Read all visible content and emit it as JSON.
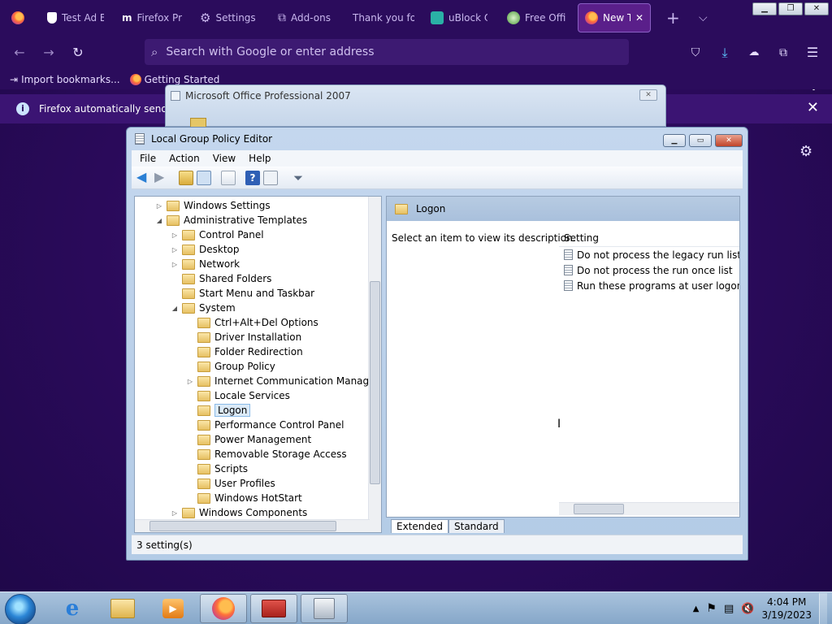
{
  "browser": {
    "tabs": [
      {
        "label": "Test Ad B",
        "icon": "shield-icon"
      },
      {
        "label": "Firefox Pr",
        "icon": "mozilla-m-icon"
      },
      {
        "label": "Settings",
        "icon": "gear-icon"
      },
      {
        "label": "Add-ons",
        "icon": "puzzle-icon"
      },
      {
        "label": "Thank you fo",
        "icon": ""
      },
      {
        "label": "uBlock O",
        "icon": "ublock-icon"
      },
      {
        "label": "Free Offic",
        "icon": "office-icon"
      },
      {
        "label": "New Ta",
        "icon": "firefox-icon",
        "active": true
      }
    ],
    "url_placeholder": "Search with Google or enter address",
    "bookmarks": [
      {
        "label": "Import bookmarks...",
        "icon": "import-icon"
      },
      {
        "label": "Getting Started",
        "icon": "firefox-icon"
      }
    ],
    "notification": "Firefox automatically sends so"
  },
  "background_dialog": {
    "title": "Microsoft Office Professional 2007"
  },
  "gpe": {
    "title": "Local Group Policy Editor",
    "menu": [
      "File",
      "Action",
      "View",
      "Help"
    ],
    "tree": [
      {
        "label": "Windows Settings",
        "level": 0,
        "exp": "▷"
      },
      {
        "label": "Administrative Templates",
        "level": 0,
        "exp": "◢"
      },
      {
        "label": "Control Panel",
        "level": 1,
        "exp": "▷"
      },
      {
        "label": "Desktop",
        "level": 1,
        "exp": "▷"
      },
      {
        "label": "Network",
        "level": 1,
        "exp": "▷"
      },
      {
        "label": "Shared Folders",
        "level": 1,
        "exp": ""
      },
      {
        "label": "Start Menu and Taskbar",
        "level": 1,
        "exp": ""
      },
      {
        "label": "System",
        "level": 1,
        "exp": "◢"
      },
      {
        "label": "Ctrl+Alt+Del Options",
        "level": 2,
        "exp": ""
      },
      {
        "label": "Driver Installation",
        "level": 2,
        "exp": ""
      },
      {
        "label": "Folder Redirection",
        "level": 2,
        "exp": ""
      },
      {
        "label": "Group Policy",
        "level": 2,
        "exp": ""
      },
      {
        "label": "Internet Communication Managen",
        "level": 2,
        "exp": "▷"
      },
      {
        "label": "Locale Services",
        "level": 2,
        "exp": ""
      },
      {
        "label": "Logon",
        "level": 2,
        "exp": "",
        "selected": true
      },
      {
        "label": "Performance Control Panel",
        "level": 2,
        "exp": ""
      },
      {
        "label": "Power Management",
        "level": 2,
        "exp": ""
      },
      {
        "label": "Removable Storage Access",
        "level": 2,
        "exp": ""
      },
      {
        "label": "Scripts",
        "level": 2,
        "exp": ""
      },
      {
        "label": "User Profiles",
        "level": 2,
        "exp": ""
      },
      {
        "label": "Windows HotStart",
        "level": 2,
        "exp": ""
      },
      {
        "label": "Windows Components",
        "level": 1,
        "exp": "▷"
      }
    ],
    "right": {
      "header": "Logon",
      "description": "Select an item to view its description.",
      "column": "Setting",
      "settings": [
        "Do not process the legacy run list",
        "Do not process the run once list",
        "Run these programs at user logon"
      ]
    },
    "view_tabs": [
      "Extended",
      "Standard"
    ],
    "status": "3 setting(s)"
  },
  "taskbar": {
    "time": "4:04 PM",
    "date": "3/19/2023"
  }
}
